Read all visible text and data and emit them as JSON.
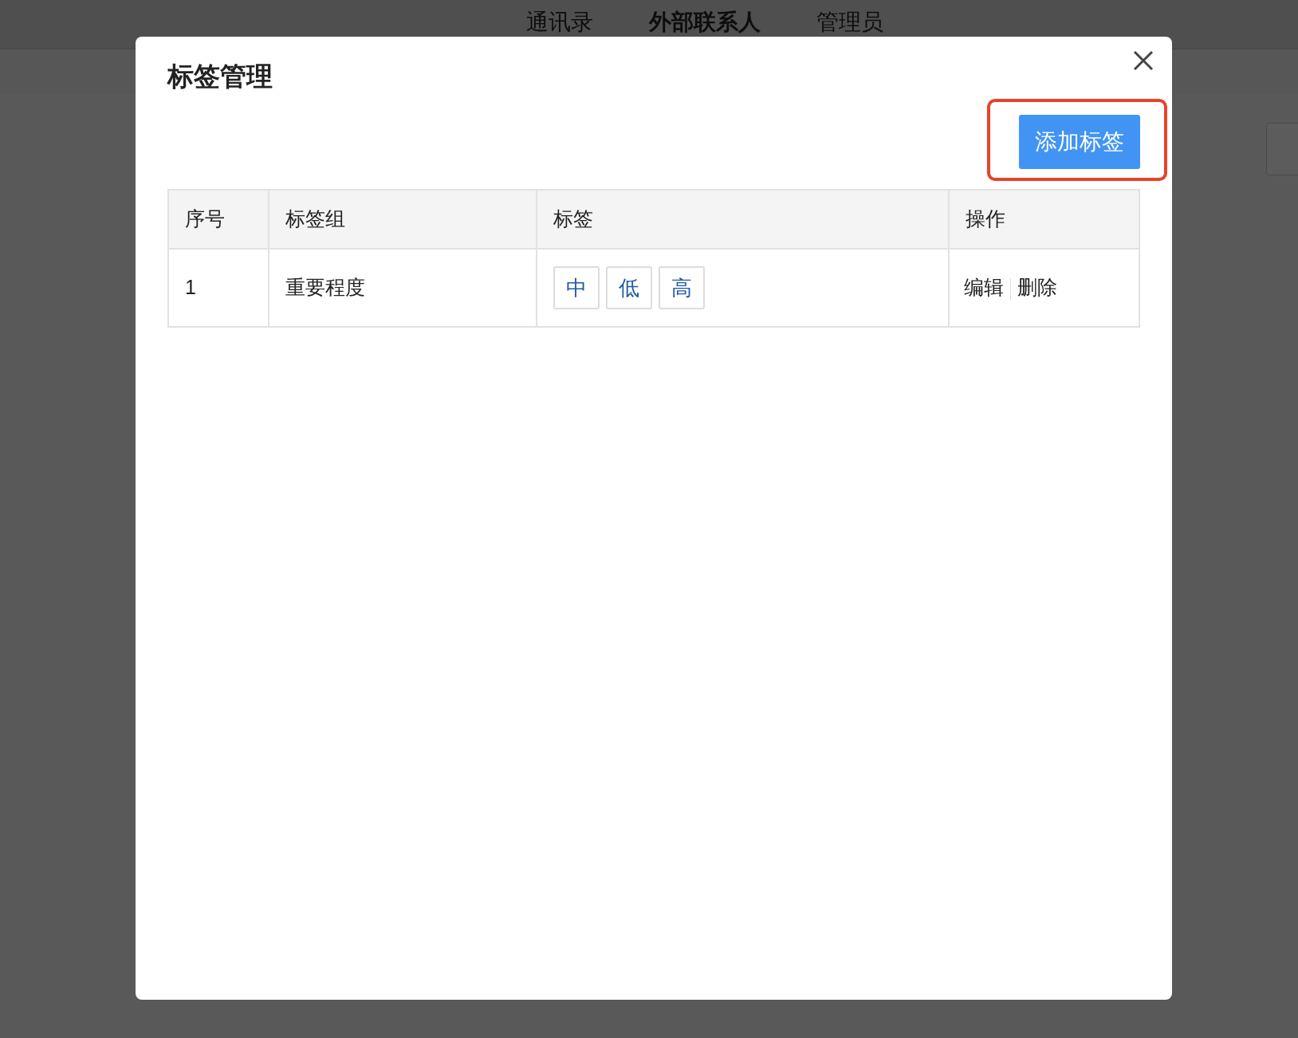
{
  "nav_tabs": [
    {
      "label": "通讯录",
      "selected": false
    },
    {
      "label": "外部联系人",
      "selected": true
    },
    {
      "label": "管理员",
      "selected": false
    }
  ],
  "dialog": {
    "title": "标签管理",
    "add_button": {
      "label": "添加标签",
      "highlighted": true
    },
    "table": {
      "columns": [
        "序号",
        "标签组",
        "标签",
        "操作"
      ],
      "rows": [
        {
          "index": "1",
          "group": "重要程度",
          "tags": [
            "中",
            "低",
            "高"
          ],
          "actions": [
            "编辑",
            "删除"
          ]
        }
      ]
    }
  }
}
